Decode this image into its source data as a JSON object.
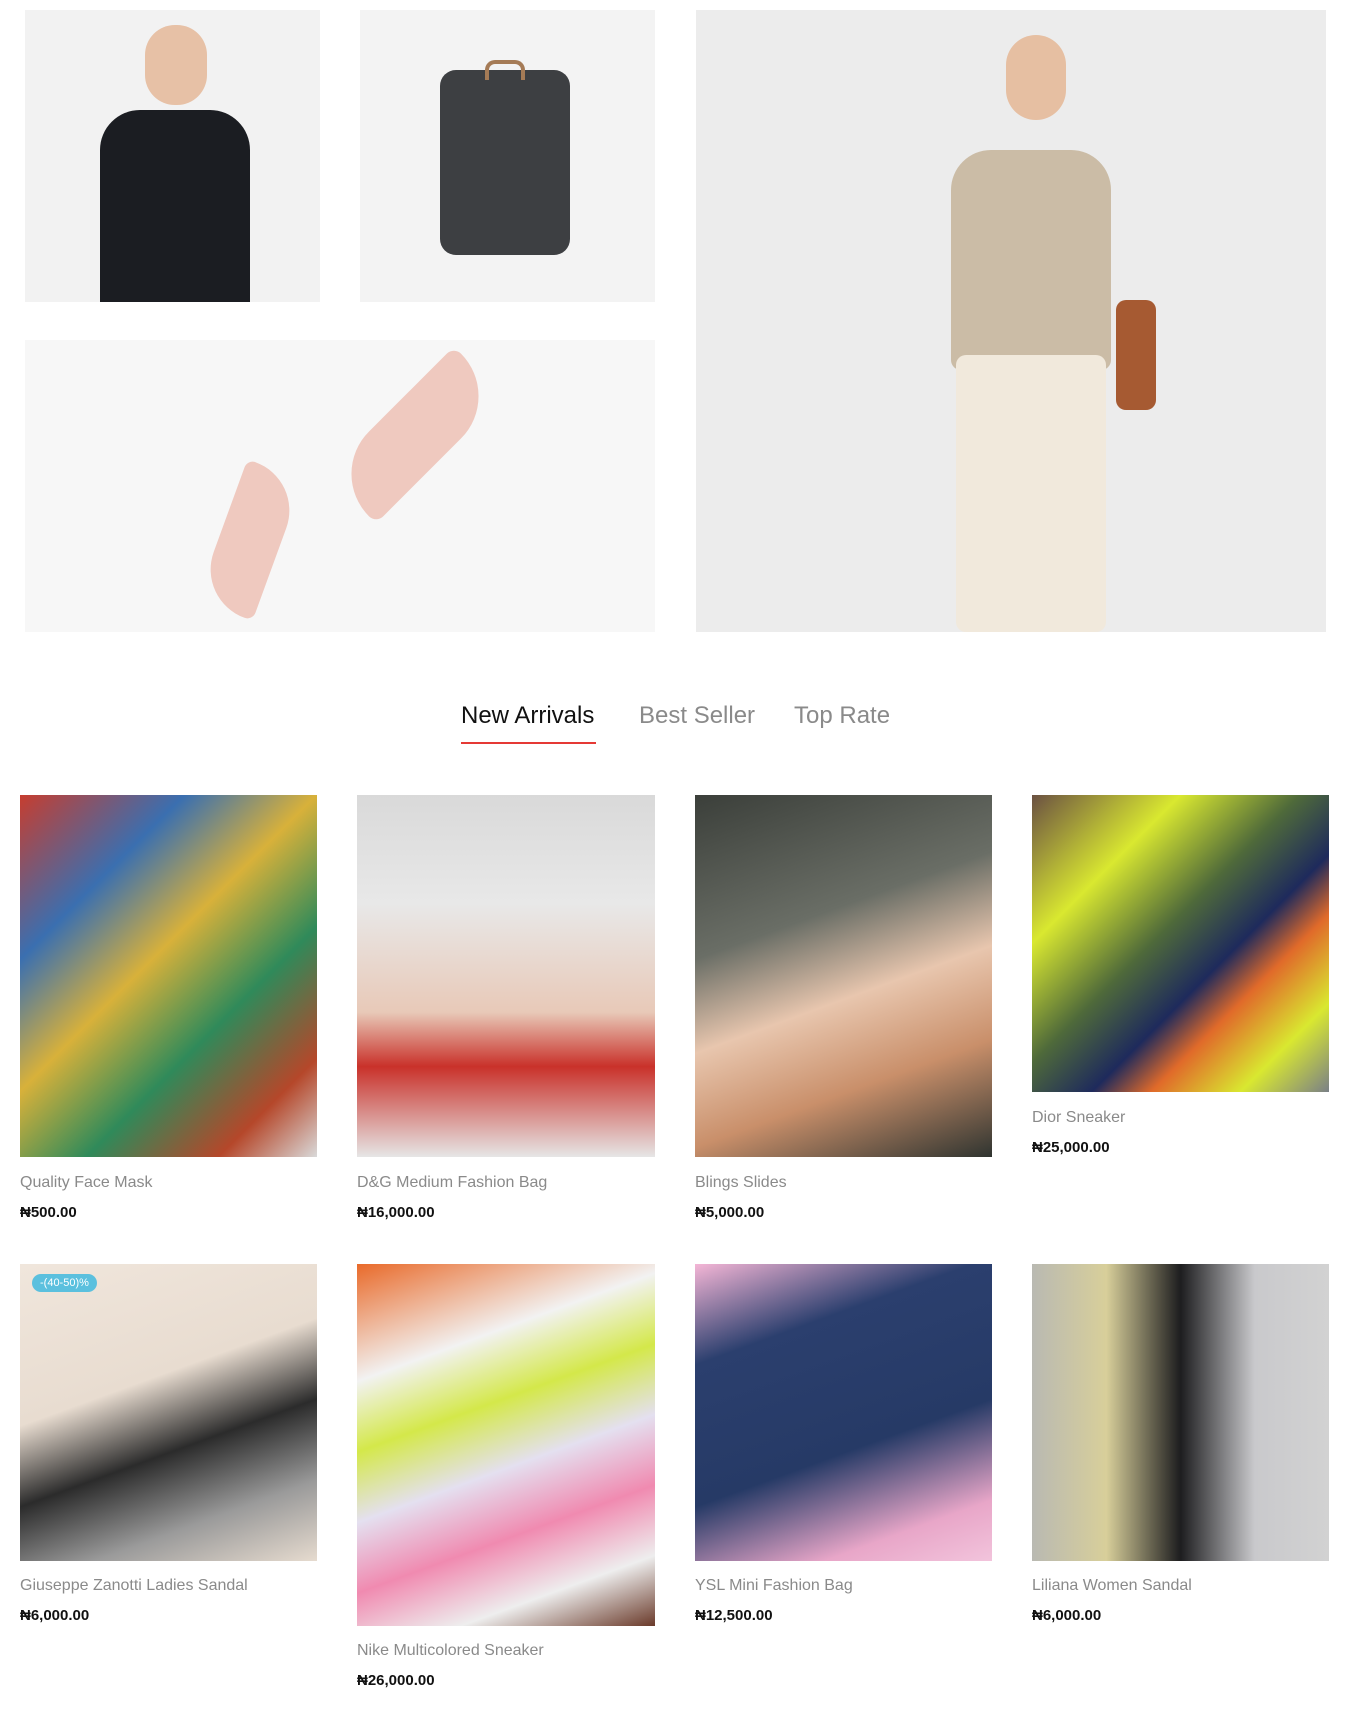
{
  "tabs": [
    {
      "label": "New Arrivals",
      "active": true
    },
    {
      "label": "Best Seller",
      "active": false
    },
    {
      "label": "Top Rate",
      "active": false
    }
  ],
  "accent_color": "#e53935",
  "badge_color": "#5bc0de",
  "products": [
    {
      "name": "Quality Face Mask",
      "price": "₦500.00"
    },
    {
      "name": "D&G Medium Fashion Bag",
      "price": "₦16,000.00"
    },
    {
      "name": "Blings Slides",
      "price": "₦5,000.00"
    },
    {
      "name": "Dior Sneaker",
      "price": "₦25,000.00"
    },
    {
      "name": "Giuseppe Zanotti Ladies Sandal",
      "price": "₦6,000.00",
      "badge": "-(40-50)%"
    },
    {
      "name": "Nike Multicolored Sneaker",
      "price": "₦26,000.00"
    },
    {
      "name": "YSL Mini Fashion Bag",
      "price": "₦12,500.00"
    },
    {
      "name": "Liliana Women Sandal",
      "price": "₦6,000.00"
    }
  ]
}
